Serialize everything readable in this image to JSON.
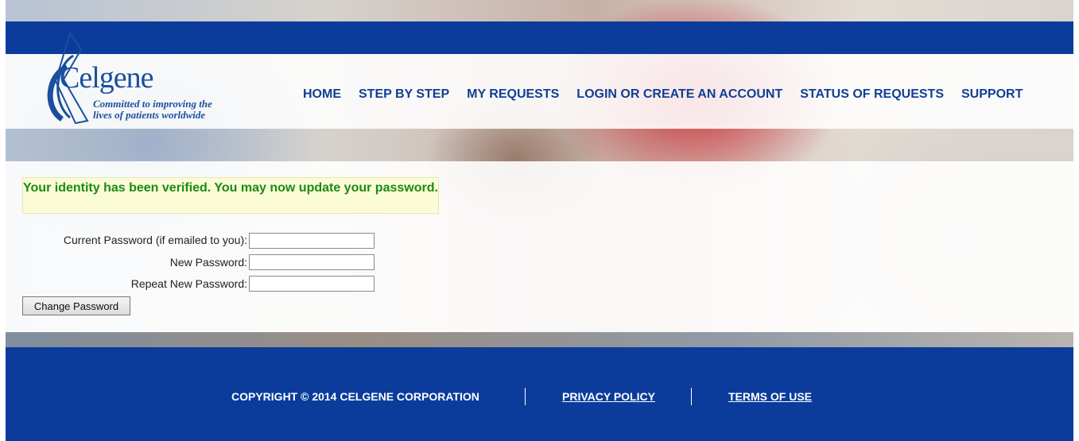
{
  "brand": {
    "name": "Celgene",
    "tagline_line1": "Committed to improving the",
    "tagline_line2": "lives of patients worldwide"
  },
  "nav": {
    "items": [
      {
        "label": "HOME"
      },
      {
        "label": "STEP BY STEP"
      },
      {
        "label": "MY REQUESTS"
      },
      {
        "label": "LOGIN OR CREATE AN ACCOUNT"
      },
      {
        "label": "STATUS OF REQUESTS"
      },
      {
        "label": "SUPPORT"
      }
    ]
  },
  "message": {
    "text": "Your identity has been verified. You may now update your password."
  },
  "form": {
    "current_password_label": "Current Password (if emailed to you):",
    "current_password_value": "",
    "new_password_label": "New Password:",
    "new_password_value": "",
    "repeat_password_label": "Repeat New Password:",
    "repeat_password_value": "",
    "submit_label": "Change Password"
  },
  "footer": {
    "copyright": "COPYRIGHT © 2014 CELGENE CORPORATION",
    "privacy": "PRIVACY POLICY",
    "terms": "TERMS OF USE"
  },
  "colors": {
    "brand_blue": "#0b3c9c",
    "nav_text": "#123f94",
    "success_text": "#1b8a14",
    "success_bg": "#fbfbd7"
  }
}
